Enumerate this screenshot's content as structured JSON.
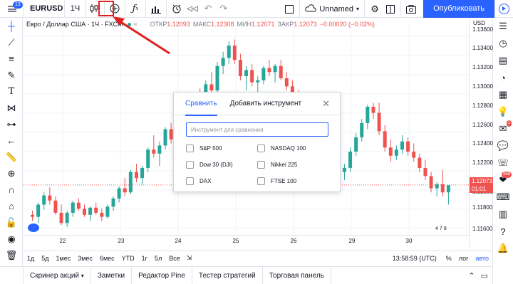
{
  "topbar": {
    "notifications_badge": "13",
    "symbol": "EURUSD",
    "interval": "1Ч",
    "icons": [
      "candles-icon",
      "compare-icon",
      "indicators-icon",
      "financials-icon",
      "alert-icon",
      "replay-icon",
      "undo-icon",
      "redo-icon"
    ],
    "layout_name": "Unnamed",
    "publish_label": "Опубликовать"
  },
  "legend": {
    "title": "Евро / Доллар США · 1Ч · FXCM",
    "open_label": "ОТКР",
    "open": "1.12093",
    "high_label": "МАКС",
    "high": "1.12308",
    "low_label": "МИН",
    "low": "1.12071",
    "close_label": "ЗАКР",
    "close": "1.12073",
    "change": "−0.00020 (−0.02%)"
  },
  "price_axis": {
    "currency": "USD",
    "labels": [
      "1.13600",
      "1.13400",
      "1.13200",
      "1.13000",
      "1.12800",
      "1.12600",
      "1.12400",
      "1.12200",
      "1.12000",
      "1.11800",
      "1.11600"
    ],
    "current_price": "1.12073",
    "countdown": "01:01"
  },
  "time_axis": {
    "labels": [
      "22",
      "23",
      "24",
      "25",
      "26",
      "29",
      "30"
    ]
  },
  "range_bar": {
    "ranges": [
      "1д",
      "5д",
      "1мес",
      "3мес",
      "6мес",
      "YTD",
      "1г",
      "5л",
      "Все"
    ],
    "clock": "13:58:59 (UTC)",
    "percent": "%",
    "log": "лог",
    "auto": "авто"
  },
  "bottom_tabs": [
    "Скринер акций",
    "Заметки",
    "Редактор Pine",
    "Тестер стратегий",
    "Торговая панель"
  ],
  "dialog": {
    "tab_compare": "Сравнить",
    "tab_add": "Добавить инструмент",
    "search_placeholder": "Инструмент для сравнения",
    "options": [
      "S&P 500",
      "NASDAQ 100",
      "Dow 30 (DJI)",
      "Nikkei 225",
      "DAX",
      "FTSE 100"
    ]
  },
  "right_sidebar": {
    "badge_ideas": "1",
    "badge_chat": "368"
  },
  "indicator_badge": [
    "4",
    "7",
    "8"
  ],
  "colors": {
    "accent": "#2962ff",
    "up": "#26a69a",
    "down": "#ef5350",
    "annotation": "#e02020"
  },
  "chart_data": {
    "type": "candlestick",
    "y_range": [
      1.1152,
      1.1365
    ],
    "candles_ohlc": [
      [
        1.1178,
        1.1182,
        1.1172,
        1.1176
      ],
      [
        1.1176,
        1.119,
        1.117,
        1.1188
      ],
      [
        1.1188,
        1.12,
        1.1183,
        1.1197
      ],
      [
        1.1197,
        1.1205,
        1.1188,
        1.1192
      ],
      [
        1.1192,
        1.1196,
        1.1178,
        1.118
      ],
      [
        1.118,
        1.1188,
        1.1168,
        1.117
      ],
      [
        1.117,
        1.1182,
        1.1166,
        1.118
      ],
      [
        1.118,
        1.1192,
        1.1176,
        1.119
      ],
      [
        1.119,
        1.1194,
        1.1182,
        1.1184
      ],
      [
        1.1184,
        1.1188,
        1.1176,
        1.1178
      ],
      [
        1.1178,
        1.1186,
        1.1172,
        1.1185
      ],
      [
        1.1185,
        1.119,
        1.1178,
        1.118
      ],
      [
        1.118,
        1.1184,
        1.1172,
        1.1176
      ],
      [
        1.1176,
        1.1188,
        1.1174,
        1.1186
      ],
      [
        1.1186,
        1.1196,
        1.1182,
        1.1194
      ],
      [
        1.1194,
        1.1206,
        1.119,
        1.1204
      ],
      [
        1.1204,
        1.1214,
        1.1196,
        1.12
      ],
      [
        1.12,
        1.1222,
        1.1198,
        1.122
      ],
      [
        1.122,
        1.1228,
        1.121,
        1.1214
      ],
      [
        1.1214,
        1.1226,
        1.1208,
        1.1224
      ],
      [
        1.1224,
        1.1244,
        1.122,
        1.1242
      ],
      [
        1.1242,
        1.1256,
        1.1234,
        1.1238
      ],
      [
        1.1238,
        1.125,
        1.1226,
        1.1246
      ],
      [
        1.1246,
        1.1264,
        1.1242,
        1.1262
      ],
      [
        1.1262,
        1.1268,
        1.1248,
        1.1252
      ],
      [
        1.1252,
        1.127,
        1.125,
        1.1266
      ],
      [
        1.1266,
        1.1278,
        1.1258,
        1.1262
      ],
      [
        1.1262,
        1.1274,
        1.1252,
        1.127
      ],
      [
        1.127,
        1.1296,
        1.1266,
        1.1292
      ],
      [
        1.1292,
        1.1302,
        1.1282,
        1.1288
      ],
      [
        1.1288,
        1.131,
        1.1284,
        1.1306
      ],
      [
        1.1306,
        1.1318,
        1.1294,
        1.13
      ],
      [
        1.13,
        1.1328,
        1.1296,
        1.1324
      ],
      [
        1.1324,
        1.1338,
        1.1316,
        1.1332
      ],
      [
        1.1332,
        1.1348,
        1.1326,
        1.1344
      ],
      [
        1.1344,
        1.135,
        1.1326,
        1.133
      ],
      [
        1.133,
        1.1336,
        1.131,
        1.1314
      ],
      [
        1.1314,
        1.1324,
        1.13,
        1.132
      ],
      [
        1.132,
        1.1326,
        1.1304,
        1.1308
      ],
      [
        1.1308,
        1.1314,
        1.1296,
        1.131
      ],
      [
        1.131,
        1.1324,
        1.1306,
        1.1322
      ],
      [
        1.1322,
        1.133,
        1.1314,
        1.1318
      ],
      [
        1.1318,
        1.1326,
        1.1308,
        1.1324
      ],
      [
        1.1324,
        1.133,
        1.131,
        1.1312
      ],
      [
        1.1312,
        1.1318,
        1.13,
        1.1304
      ],
      [
        1.1304,
        1.131,
        1.129,
        1.1294
      ],
      [
        1.1294,
        1.13,
        1.128,
        1.1284
      ],
      [
        1.123,
        1.1238,
        1.122,
        1.1234
      ],
      [
        1.1234,
        1.1246,
        1.1228,
        1.1242
      ],
      [
        1.1242,
        1.1252,
        1.1234,
        1.1238
      ],
      [
        1.1238,
        1.1244,
        1.1226,
        1.123
      ],
      [
        1.123,
        1.1236,
        1.1218,
        1.1222
      ],
      [
        1.1222,
        1.123,
        1.1214,
        1.1226
      ],
      [
        1.1226,
        1.1234,
        1.1216,
        1.122
      ],
      [
        1.122,
        1.1228,
        1.1212,
        1.1224
      ],
      [
        1.1224,
        1.1244,
        1.122,
        1.124
      ],
      [
        1.124,
        1.1258,
        1.1236,
        1.1254
      ],
      [
        1.1254,
        1.1272,
        1.125,
        1.1268
      ],
      [
        1.1268,
        1.1286,
        1.1262,
        1.1284
      ],
      [
        1.1284,
        1.1288,
        1.1272,
        1.1278
      ],
      [
        1.1278,
        1.1288,
        1.1256,
        1.126
      ],
      [
        1.126,
        1.1266,
        1.124,
        1.1244
      ],
      [
        1.1244,
        1.1252,
        1.123,
        1.1236
      ],
      [
        1.1236,
        1.1246,
        1.1232,
        1.1242
      ],
      [
        1.1242,
        1.1256,
        1.1238,
        1.125
      ],
      [
        1.125,
        1.1254,
        1.1236,
        1.124
      ],
      [
        1.124,
        1.1248,
        1.123,
        1.1234
      ],
      [
        1.1234,
        1.1238,
        1.122,
        1.1224
      ],
      [
        1.1224,
        1.1232,
        1.1212,
        1.1216
      ],
      [
        1.1216,
        1.122,
        1.12,
        1.1204
      ],
      [
        1.1204,
        1.121,
        1.1196,
        1.1208
      ],
      [
        1.1208,
        1.1222,
        1.1196,
        1.12
      ],
      [
        1.12,
        1.1204,
        1.1188,
        1.1207
      ]
    ]
  }
}
